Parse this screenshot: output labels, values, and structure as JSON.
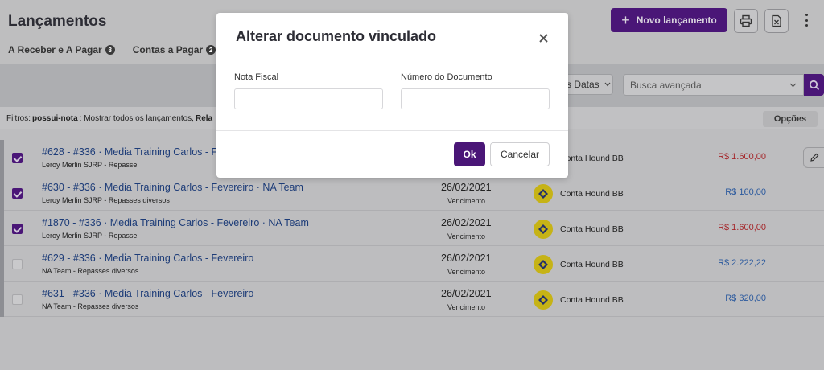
{
  "header": {
    "title": "Lançamentos",
    "tabs": [
      {
        "label": "A Receber e A Pagar",
        "count": "8"
      },
      {
        "label": "Contas a Pagar",
        "count": "2"
      }
    ],
    "new_button_label": "Novo lançamento",
    "accent_color": "#5b1a93"
  },
  "toolbar": {
    "date_filter_label": "s Datas",
    "search_placeholder": "Busca avançada",
    "filters_prefix": "Filtros:",
    "filters_key": "possui-nota",
    "filters_text": ": Mostrar todos os lançamentos,",
    "filters_more": "Rela",
    "options_label": "Opções"
  },
  "rows": [
    {
      "title": "#628 - #336 · Media Training Carlos - F",
      "sub": "Leroy Merlin SJRP - Repasse",
      "date": "",
      "due": "",
      "bank": "Conta Hound BB",
      "amount": "R$ 1.600,00",
      "type": "neg",
      "checked": true
    },
    {
      "title": "#630 - #336 · Media Training Carlos - Fevereiro · NA Team",
      "sub": "Leroy Merlin SJRP - Repasses diversos",
      "date": "26/02/2021",
      "due": "Vencimento",
      "bank": "Conta Hound BB",
      "amount": "R$ 160,00",
      "type": "pos",
      "checked": true
    },
    {
      "title": "#1870 - #336 · Media Training Carlos - Fevereiro · NA Team",
      "sub": "Leroy Merlin SJRP - Repasse",
      "date": "26/02/2021",
      "due": "Vencimento",
      "bank": "Conta Hound BB",
      "amount": "R$ 1.600,00",
      "type": "neg",
      "checked": true
    },
    {
      "title": "#629 - #336 · Media Training Carlos - Fevereiro",
      "sub": "NA Team - Repasses diversos",
      "date": "26/02/2021",
      "due": "Vencimento",
      "bank": "Conta Hound BB",
      "amount": "R$ 2.222,22",
      "type": "pos",
      "checked": false
    },
    {
      "title": "#631 - #336 · Media Training Carlos - Fevereiro",
      "sub": "NA Team - Repasses diversos",
      "date": "26/02/2021",
      "due": "Vencimento",
      "bank": "Conta Hound BB",
      "amount": "R$ 320,00",
      "type": "pos",
      "checked": false
    }
  ],
  "modal": {
    "title": "Alterar documento vinculado",
    "nota_fiscal_label": "Nota Fiscal",
    "nota_fiscal_value": "",
    "numero_documento_label": "Número do Documento",
    "numero_documento_value": "",
    "ok_label": "Ok",
    "cancel_label": "Cancelar"
  },
  "icons": {
    "close": "close-icon",
    "print": "printer-icon",
    "excel": "excel-icon",
    "search": "search-icon",
    "edit": "pencil-icon",
    "more": "kebab-menu-icon",
    "bank": "banco-do-brasil-logo"
  }
}
